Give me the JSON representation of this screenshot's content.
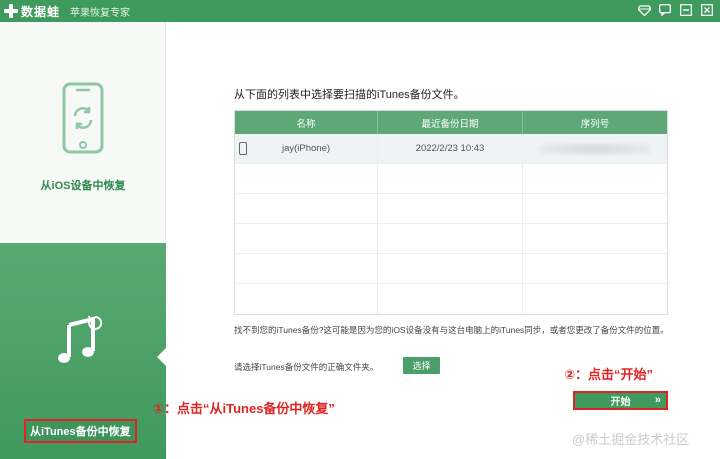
{
  "titlebar": {
    "logo_text": "数据蛙",
    "subtitle": "苹果恢复专家",
    "icons": [
      "gem-icon",
      "feedback-icon",
      "minimize-icon",
      "close-icon"
    ]
  },
  "sidebar": {
    "items": [
      {
        "label": "从iOS设备中恢复",
        "icon": "phone-restore-icon",
        "active": false
      },
      {
        "label": "从iTunes备份中恢复",
        "icon": "music-note-icon",
        "active": true
      }
    ]
  },
  "main": {
    "instruction": "从下面的列表中选择要扫描的iTunes备份文件。",
    "table": {
      "headers": [
        "名称",
        "最近备份日期",
        "序列号"
      ],
      "rows": [
        {
          "name": "jay(iPhone)",
          "date": "2022/2/23 10:43",
          "serial": ""
        }
      ]
    },
    "note": "找不到您的iTunes备份?这可能是因为您的iOS设备没有与这台电脑上的iTunes同步，或者您更改了备份文件的位置。",
    "pick_label": "请选择iTunes备份文件的正确文件夹。",
    "pick_button": "选择",
    "start_button": "开始",
    "start_chevron": "»"
  },
  "annotations": {
    "step1": "①：点击“从iTunes备份中恢复”",
    "step2": "②：点击“开始”"
  },
  "watermark": "@稀土掘金技术社区",
  "colors": {
    "brand_green": "#3f9a5e",
    "table_header": "#5ea878",
    "highlight_red": "#e02424"
  }
}
